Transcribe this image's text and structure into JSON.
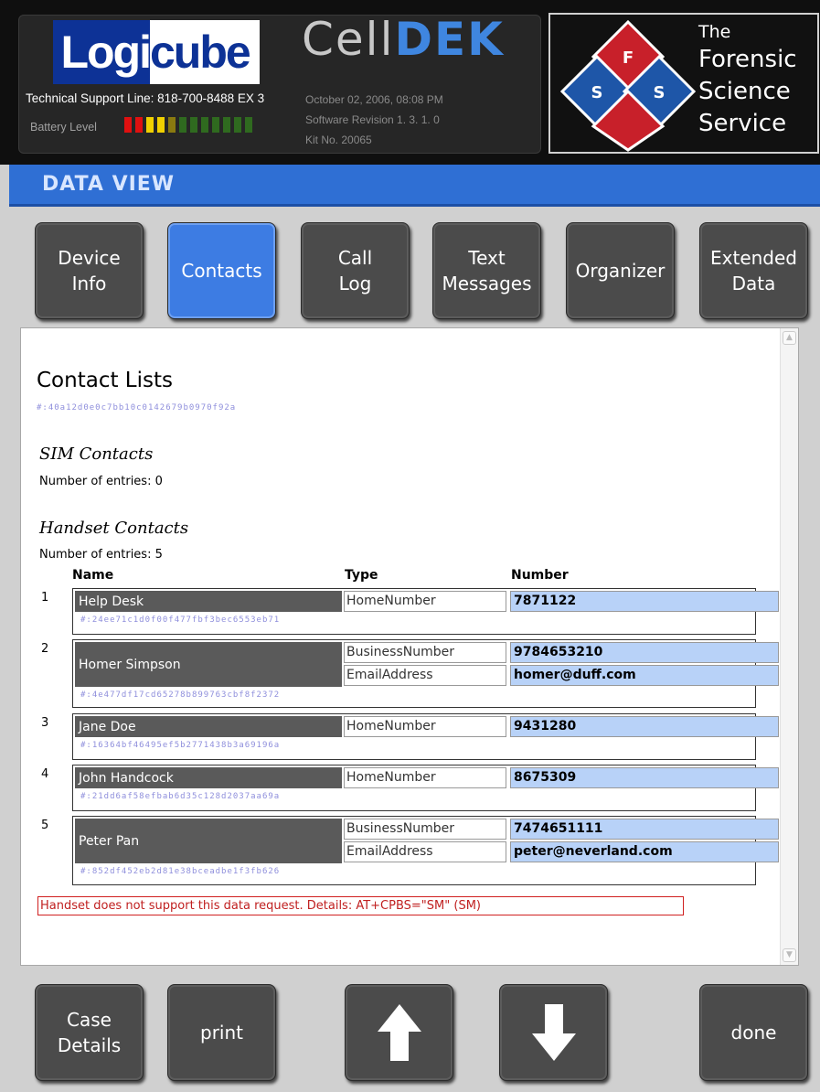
{
  "header": {
    "logo_part1": "Logi",
    "logo_part2": "cube",
    "support_line": "Technical Support Line: 818-700-8488 EX 3",
    "battery_label": "Battery Level",
    "battery_level": 0.3,
    "app_title_light": "Cell",
    "app_title_bold": "DEK",
    "date": "October 02, 2006, 08:08 PM",
    "software_revision": "Software Revision 1. 3. 1. 0",
    "kit_no": "Kit No. 20065",
    "fss_the": "The",
    "fss_forensic": "Forensic",
    "fss_science": "Science",
    "fss_service": "Service",
    "fss_logo_letters": [
      "F",
      "S",
      "S"
    ]
  },
  "view_title": "DATA VIEW",
  "tabs": [
    {
      "label": "Device\nInfo",
      "active": false
    },
    {
      "label": "Contacts",
      "active": true
    },
    {
      "label": "Call\nLog",
      "active": false
    },
    {
      "label": "Text\nMessages",
      "active": false
    },
    {
      "label": "Organizer",
      "active": false
    },
    {
      "label": "Extended\nData",
      "active": false
    }
  ],
  "content": {
    "title": "Contact Lists",
    "title_hash": "#:40a12d0e0c7bb10c0142679b0970f92a",
    "sim_heading": "SIM Contacts",
    "sim_count": "Number of entries: 0",
    "handset_heading": "Handset Contacts",
    "handset_count": "Number of entries: 5",
    "columns": {
      "name": "Name",
      "type": "Type",
      "number": "Number"
    },
    "contacts": [
      {
        "index": "1",
        "name": "Help Desk",
        "hash": "#:24ee71c1d0f00f477fbf3bec6553eb71",
        "entries": [
          {
            "type": "HomeNumber",
            "number": "7871122"
          }
        ]
      },
      {
        "index": "2",
        "name": "Homer Simpson",
        "hash": "#:4e477df17cd65278b899763cbf8f2372",
        "entries": [
          {
            "type": "BusinessNumber",
            "number": "9784653210"
          },
          {
            "type": "EmailAddress",
            "number": "homer@duff.com"
          }
        ]
      },
      {
        "index": "3",
        "name": "Jane Doe",
        "hash": "#:16364bf46495ef5b2771438b3a69196a",
        "entries": [
          {
            "type": "HomeNumber",
            "number": "9431280"
          }
        ]
      },
      {
        "index": "4",
        "name": "John Handcock",
        "hash": "#:21dd6af58efbab6d35c128d2037aa69a",
        "entries": [
          {
            "type": "HomeNumber",
            "number": "8675309"
          }
        ]
      },
      {
        "index": "5",
        "name": "Peter Pan",
        "hash": "#:852df452eb2d81e38bceadbe1f3fb626",
        "entries": [
          {
            "type": "BusinessNumber",
            "number": "7474651111"
          },
          {
            "type": "EmailAddress",
            "number": "peter@neverland.com"
          }
        ]
      }
    ],
    "error": "Handset does not support this data request. Details: AT+CPBS=\"SM\" (SM)"
  },
  "footer": {
    "case_details": "Case\nDetails",
    "print": "print",
    "up_icon": "arrow-up-icon",
    "down_icon": "arrow-down-icon",
    "done": "done"
  }
}
